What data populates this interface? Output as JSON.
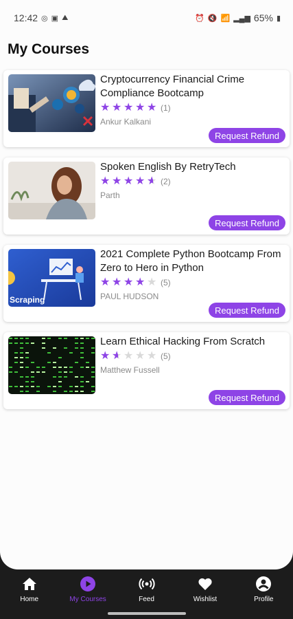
{
  "status_bar": {
    "time": "12:42",
    "battery": "65%"
  },
  "page": {
    "title": "My Courses"
  },
  "courses": [
    {
      "title": "Cryptocurrency Financial Crime Compliance Bootcamp",
      "rating": 5,
      "reviews": "(1)",
      "author": "Ankur Kalkani",
      "button": "Request Refund"
    },
    {
      "title": "Spoken English By RetryTech",
      "rating": 4.5,
      "reviews": "(2)",
      "author": "Parth",
      "button": "Request Refund"
    },
    {
      "title": "2021 Complete Python Bootcamp From Zero to Hero in Python",
      "rating": 4,
      "reviews": "(5)",
      "author": "PAUL HUDSON",
      "button": "Request Refund",
      "thumb_caption": "Scraping"
    },
    {
      "title": "Learn Ethical Hacking From Scratch",
      "rating": 1.5,
      "reviews": "(5)",
      "author": "Matthew Fussell",
      "button": "Request Refund"
    }
  ],
  "nav": {
    "items": [
      {
        "label": "Home",
        "icon": "home-icon"
      },
      {
        "label": "My Courses",
        "icon": "play-circle-icon",
        "active": true
      },
      {
        "label": "Feed",
        "icon": "broadcast-icon"
      },
      {
        "label": "Wishlist",
        "icon": "heart-icon"
      },
      {
        "label": "Profile",
        "icon": "profile-icon"
      }
    ]
  },
  "colors": {
    "accent": "#8e44e6",
    "nav_background": "#1c1c1c"
  }
}
